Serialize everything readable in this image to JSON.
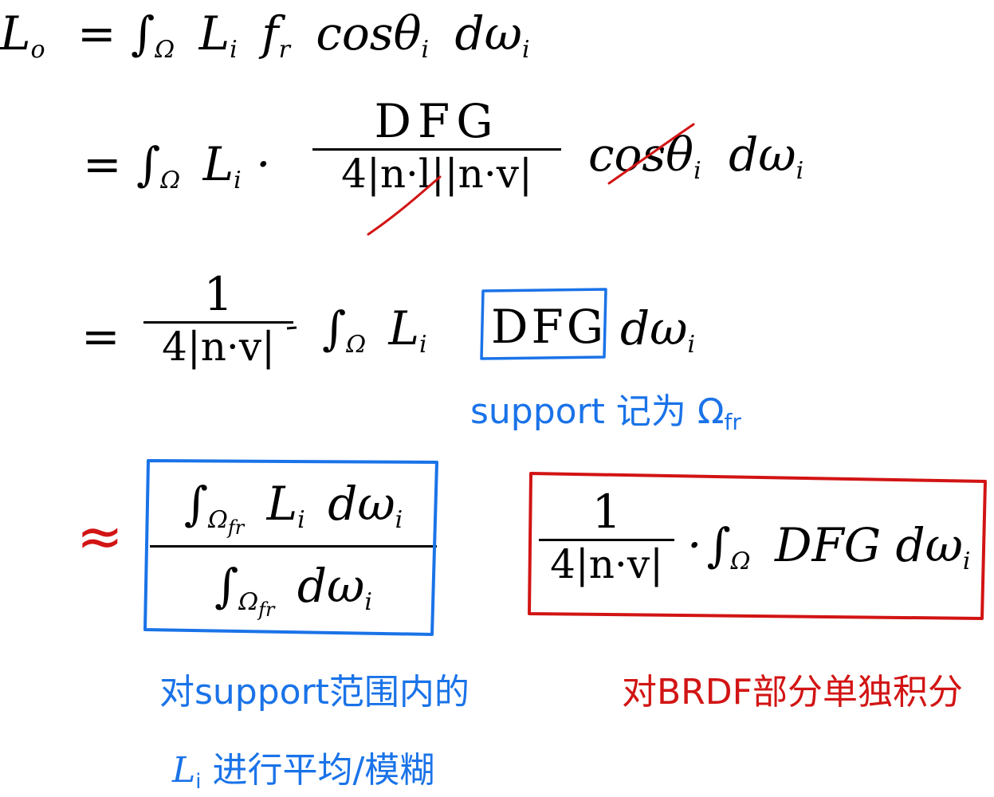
{
  "eq1": {
    "lhs": "L",
    "lhs_sub": "o",
    "rhs": "= ∫",
    "omega": "Ω",
    "terms": "L",
    "i": "i",
    "fr": "f",
    "r": "r",
    "cos": "cosθ",
    "dw": "dω"
  },
  "eq2": {
    "eq": "= ∫",
    "omega": "Ω",
    "L": "L",
    "i": "i",
    "dot": "·",
    "num": "DFG",
    "den_left": "4|n·l|",
    "den_right": "|n·v|",
    "cos": "cosθ",
    "dw": "dω"
  },
  "eq3": {
    "eq": "=",
    "num": "1",
    "den": "4|n·v|",
    "int": "∫",
    "omega": "Ω",
    "L": "L",
    "i": "i",
    "boxed": "DFG",
    "dw": "dω"
  },
  "support_note": "support 记为 Ω",
  "support_sub": "fr",
  "approx": "≈",
  "left_box": {
    "num_int": "∫",
    "omega": "Ω",
    "sub": "fr",
    "num_rest": "L",
    "i": "i",
    "dw": "dω",
    "den_int": "∫",
    "den_dw": "dω"
  },
  "right_box": {
    "num": "1",
    "den": "4|n·v|",
    "dot": "·",
    "int": "∫",
    "omega": "Ω",
    "rest": "DFG dω",
    "i": "i"
  },
  "left_caption_line1": "对support范围内的",
  "left_caption_line2_L": "L",
  "left_caption_line2_i": "i",
  "left_caption_line2_rest": " 进行平均/模糊",
  "right_caption": "对BRDF部分单独积分",
  "colors": {
    "blue": "#1a73e8",
    "red": "#d21414",
    "ink": "#000000"
  }
}
